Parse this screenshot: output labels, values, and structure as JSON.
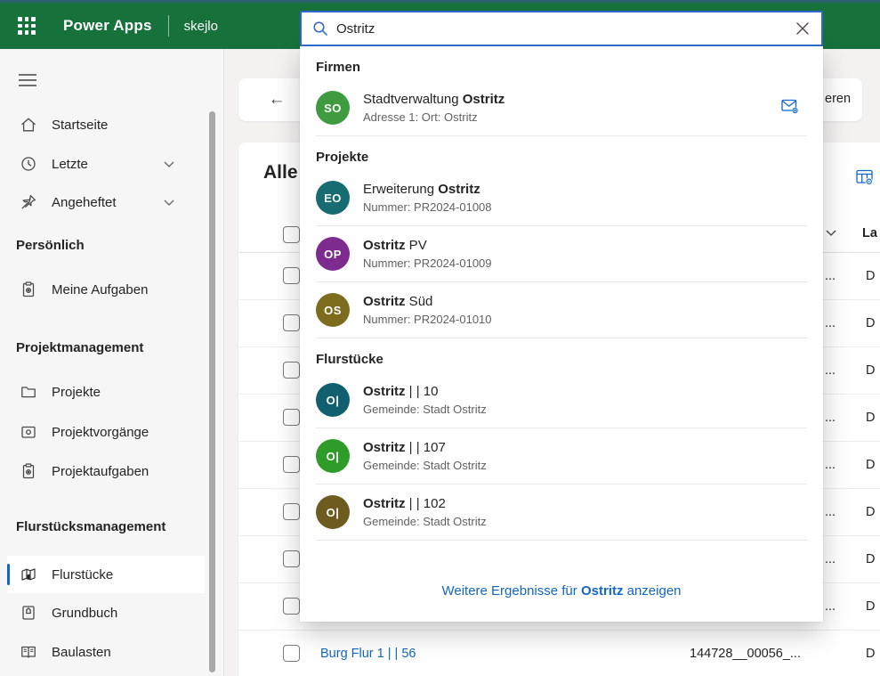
{
  "topbar": {
    "brand": "Power Apps",
    "environment": "skejlo"
  },
  "search": {
    "value": "Ostritz"
  },
  "sidebar": {
    "primary": [
      {
        "label": "Startseite"
      },
      {
        "label": "Letzte"
      },
      {
        "label": "Angeheftet"
      }
    ],
    "sections": [
      {
        "header": "Persönlich",
        "items": [
          {
            "label": "Meine Aufgaben"
          }
        ]
      },
      {
        "header": "Projektmanagement",
        "items": [
          {
            "label": "Projekte"
          },
          {
            "label": "Projektvorgänge"
          },
          {
            "label": "Projektaufgaben"
          }
        ]
      },
      {
        "header": "Flurstücksmanagement",
        "items": [
          {
            "label": "Flurstücke"
          },
          {
            "label": "Grundbuch"
          },
          {
            "label": "Baulasten"
          }
        ]
      }
    ]
  },
  "search_results": {
    "sections": [
      {
        "header": "Firmen",
        "items": [
          {
            "initials": "SO",
            "color": "#3f9b3f",
            "title_pre": "Stadtverwaltung ",
            "title_bold": "Ostritz",
            "title_post": "",
            "subtitle": "Adresse 1: Ort: Ostritz"
          }
        ]
      },
      {
        "header": "Projekte",
        "items": [
          {
            "initials": "EO",
            "color": "#176c72",
            "title_pre": "Erweiterung ",
            "title_bold": "Ostritz",
            "title_post": "",
            "subtitle": "Nummer: PR2024-01008"
          },
          {
            "initials": "OP",
            "color": "#7d2b8f",
            "title_pre": "",
            "title_bold": "Ostritz",
            "title_post": " PV",
            "subtitle": "Nummer: PR2024-01009"
          },
          {
            "initials": "OS",
            "color": "#7d6b1e",
            "title_pre": "",
            "title_bold": "Ostritz",
            "title_post": " Süd",
            "subtitle": "Nummer: PR2024-01010"
          }
        ]
      },
      {
        "header": "Flurstücke",
        "items": [
          {
            "initials": "O|",
            "color": "#11606f",
            "title_pre": "",
            "title_bold": "Ostritz",
            "title_post": " | | 10",
            "subtitle": "Gemeinde: Stadt Ostritz"
          },
          {
            "initials": "O|",
            "color": "#2f9b28",
            "title_pre": "",
            "title_bold": "Ostritz",
            "title_post": " | | 107",
            "subtitle": "Gemeinde: Stadt Ostritz"
          },
          {
            "initials": "O|",
            "color": "#6e5b20",
            "title_pre": "",
            "title_bold": "Ostritz",
            "title_post": " | | 102",
            "subtitle": "Gemeinde: Stadt Ostritz"
          }
        ]
      }
    ],
    "footer": {
      "pre": "Weitere Ergebnisse für ",
      "bold": "Ostritz",
      "post": " anzeigen"
    }
  },
  "main": {
    "command_bar": {
      "back": "←",
      "partial_label": "eren"
    },
    "view_title": "Alle",
    "grid": {
      "header_partial_label": "La",
      "rows": [
        {
          "value_tail": "...",
          "land_partial": "D"
        },
        {
          "value_tail": "...",
          "land_partial": "D"
        },
        {
          "value_tail": "...",
          "land_partial": "D"
        },
        {
          "value_tail": "...",
          "land_partial": "D"
        },
        {
          "value_tail": "...",
          "land_partial": "D"
        },
        {
          "value_tail": "...",
          "land_partial": "D"
        },
        {
          "value_tail": "...",
          "land_partial": "D"
        },
        {
          "value_tail": "...",
          "land_partial": "D"
        },
        {
          "name": "Burg Flur 1 | | 56",
          "value": "144728__00056_...",
          "land_partial": "D"
        }
      ]
    }
  },
  "colors": {
    "header_green": "#16713a",
    "top_strip_teal": "#2d5f6e",
    "search_border_blue": "#2e68cc",
    "accent_blue": "#1267c1",
    "link_blue": "#1267c1"
  }
}
